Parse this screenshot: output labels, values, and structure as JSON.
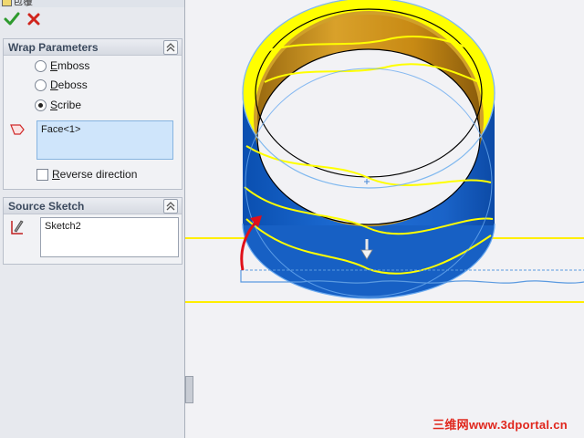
{
  "window": {
    "title": "包覆"
  },
  "actions": {
    "ok_icon": "check-icon",
    "cancel_icon": "close-icon"
  },
  "wrap_parameters": {
    "title": "Wrap Parameters",
    "options": [
      {
        "first": "E",
        "rest": "mboss",
        "selected": false
      },
      {
        "first": "D",
        "rest": "eboss",
        "selected": false
      },
      {
        "first": "S",
        "rest": "cribe",
        "selected": true
      }
    ],
    "face_selection": "Face<1>",
    "reverse_direction": {
      "first": "R",
      "rest": "everse direction",
      "checked": false
    }
  },
  "source_sketch": {
    "title": "Source Sketch",
    "value": "Sketch2"
  },
  "watermark": "三维网www.3dportal.cn",
  "colors": {
    "accent_yellow": "#ffff00",
    "part_blue": "#1a66cc",
    "inner_gold": "#d79a1c",
    "arrow_red": "#e0101a"
  }
}
